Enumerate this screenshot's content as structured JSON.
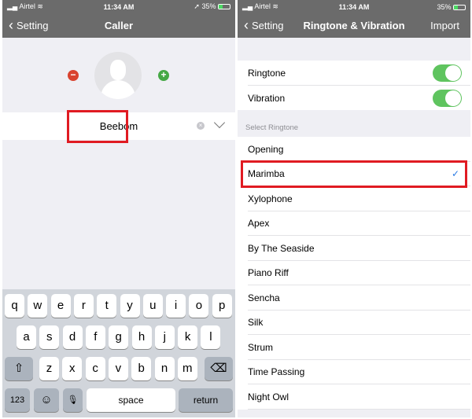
{
  "left": {
    "status": {
      "carrier": "Airtel",
      "time": "11:34 AM",
      "battery": "35%",
      "battery_level": 0.35
    },
    "nav": {
      "back": "Setting",
      "title": "Caller"
    },
    "name_value": "Beebom",
    "keyboard": {
      "row1": [
        "q",
        "w",
        "e",
        "r",
        "t",
        "y",
        "u",
        "i",
        "o",
        "p"
      ],
      "row2": [
        "a",
        "s",
        "d",
        "f",
        "g",
        "h",
        "j",
        "k",
        "l"
      ],
      "row3": [
        "z",
        "x",
        "c",
        "v",
        "b",
        "n",
        "m"
      ],
      "numbers": "123",
      "space": "space",
      "return": "return",
      "shift": "⇧",
      "delete": "⌫",
      "emoji": "☺",
      "mic": "🎙"
    }
  },
  "right": {
    "status": {
      "carrier": "Airtel",
      "time": "11:34 AM",
      "battery": "35%",
      "battery_level": 0.35
    },
    "nav": {
      "back": "Setting",
      "title": "Ringtone & Vibration",
      "action": "Import"
    },
    "toggles": [
      {
        "label": "Ringtone",
        "on": true
      },
      {
        "label": "Vibration",
        "on": true
      }
    ],
    "section_header": "Select Ringtone",
    "ringtones": [
      "Opening",
      "Marimba",
      "Xylophone",
      "Apex",
      "By The Seaside",
      "Piano Riff",
      "Sencha",
      "Silk",
      "Strum",
      "Time Passing",
      "Night Owl"
    ],
    "selected": "Marimba",
    "check": "✓",
    "accent": "#2a7be4"
  }
}
